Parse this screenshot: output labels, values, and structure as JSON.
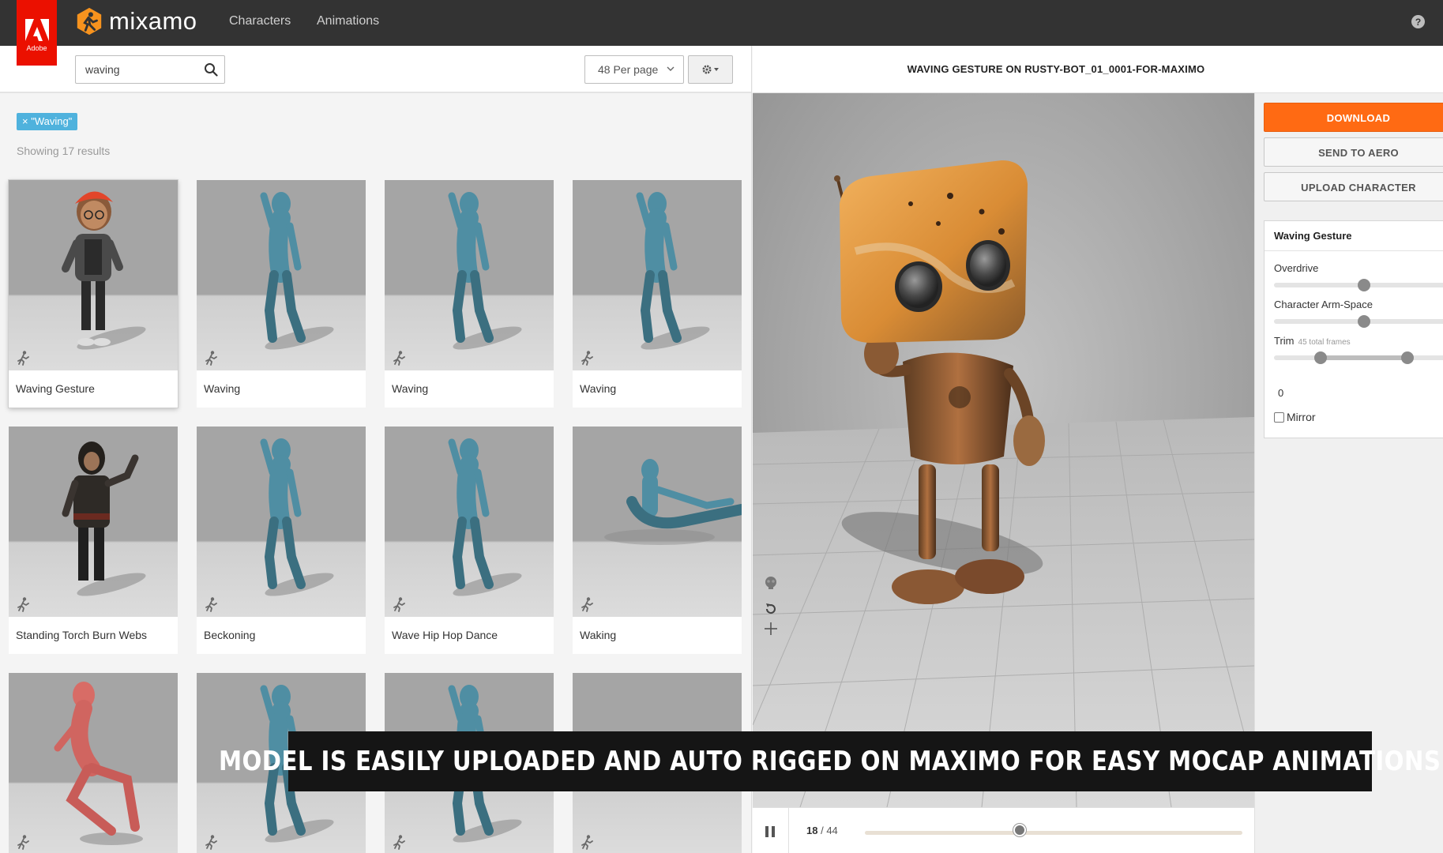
{
  "app": {
    "brand": "mixamo",
    "adobe_badge": "Adobe",
    "nav": [
      "Characters",
      "Animations"
    ],
    "help_glyph": "?"
  },
  "search": {
    "value": "waving",
    "placeholder": "Search",
    "per_page": "48 Per page",
    "filter_tag": "× \"Waving\"",
    "results": "Showing 17 results"
  },
  "grid": {
    "cards": [
      {
        "label": "Waving Gesture",
        "figure": "cartoon-boy",
        "selected": true
      },
      {
        "label": "Waving",
        "figure": "blue-mannequin"
      },
      {
        "label": "Waving",
        "figure": "blue-mannequin"
      },
      {
        "label": "Waving",
        "figure": "blue-mannequin"
      },
      {
        "label": "Standing Torch Burn Webs",
        "figure": "hooded-figure"
      },
      {
        "label": "Beckoning",
        "figure": "blue-mannequin"
      },
      {
        "label": "Wave Hip Hop Dance",
        "figure": "blue-mannequin"
      },
      {
        "label": "Waking",
        "figure": "blue-mannequin-lying"
      },
      {
        "label": "",
        "figure": "red-mannequin"
      },
      {
        "label": "",
        "figure": "blue-mannequin"
      },
      {
        "label": "",
        "figure": "blue-mannequin"
      },
      {
        "label": "",
        "figure": "empty"
      }
    ]
  },
  "viewer": {
    "title": "WAVING GESTURE ON RUSTY-BOT_01_0001-FOR-MAXIMO",
    "current_frame": "18",
    "frame_sep": " / ",
    "total_frames": "44",
    "progress": 0.41
  },
  "panel": {
    "download": "DOWNLOAD",
    "send_to_aero": "SEND TO AERO",
    "upload_character": "UPLOAD CHARACTER",
    "title": "Waving Gesture",
    "overdrive_label": "Overdrive",
    "overdrive_value": 0.5,
    "arm_space_label": "Character Arm-Space",
    "arm_space_value": 0.5,
    "trim_label": "Trim",
    "trim_sub": "45 total frames",
    "trim_start": 0.26,
    "trim_end": 0.74,
    "trim_value": "0",
    "mirror_label": "Mirror",
    "mirror_checked": false
  },
  "colors": {
    "accent_orange": "#ff6a13",
    "filter_blue": "#4fb2dd",
    "adobe_red": "#eb1000",
    "topbar": "#333333"
  },
  "caption": "MODEL IS EASILY UPLOADED AND AUTO RIGGED ON MAXIMO FOR EASY MOCAP ANIMATIONS"
}
